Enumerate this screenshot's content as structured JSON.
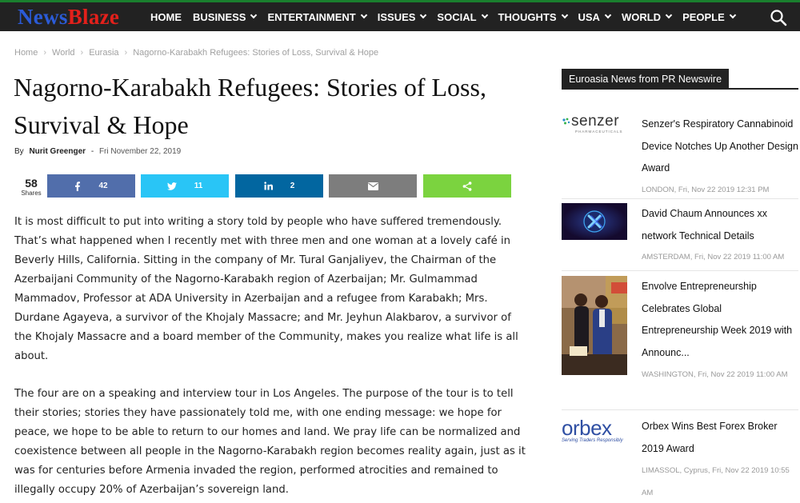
{
  "site": {
    "logo_part1": "News",
    "logo_part2": "Blaze"
  },
  "nav": {
    "items": [
      "HOME",
      "BUSINESS",
      "ENTERTAINMENT",
      "ISSUES",
      "SOCIAL",
      "THOUGHTS",
      "USA",
      "WORLD",
      "PEOPLE"
    ],
    "search_icon": "search-icon"
  },
  "breadcrumb": [
    "Home",
    "World",
    "Eurasia",
    "Nagorno-Karabakh Refugees: Stories of Loss, Survival & Hope"
  ],
  "article": {
    "title": "Nagorno-Karabakh Refugees: Stories of Loss, Survival & Hope",
    "by": "By",
    "author": "Nurit Greenger",
    "separator": "-",
    "date": "Fri November 22, 2019",
    "paragraphs": [
      "It is most difficult to put into writing a story told by people who have suffered tremendously. That’s what happened when I recently met with three men and one woman at a lovely café in Beverly Hills, California. Sitting in the company of Mr. Tural Ganjaliyev, the Chairman of the Azerbaijani Community of the Nagorno-Karabakh region of Azerbaijan; Mr. Gulmammad Mammadov, Professor at ADA University in Azerbaijan and a refugee from Karabakh; Mrs. Durdane Agayeva, a survivor of the Khojaly Massacre; and Mr. Jeyhun Alakbarov, a survivor of the Khojaly Massacre and a board member of the Community, makes you realize what life is all about.",
      "The four are on a speaking and interview tour in Los Angeles. The purpose of the tour is to tell their stories; stories they have passionately told me, with one ending message: we hope for peace, we hope to be able to return to our homes and land. We pray life can be normalized and coexistence between all people in the Nagorno-Karabakh region becomes reality again, just as it was for centuries before Armenia invaded the region, performed atrocities and remained to illegally occupy 20% of Azerbaijan’s sovereign land."
    ]
  },
  "share": {
    "total": "58",
    "total_label": "Shares",
    "buttons": [
      {
        "network": "facebook",
        "count": "42",
        "color": "#516eab",
        "icon": "facebook-icon"
      },
      {
        "network": "twitter",
        "count": "11",
        "color": "#29c5f6",
        "icon": "twitter-icon"
      },
      {
        "network": "linkedin",
        "count": "2",
        "color": "#0266a0",
        "icon": "linkedin-icon"
      },
      {
        "network": "email",
        "count": "",
        "color": "#7d7d7d",
        "icon": "mail-icon"
      },
      {
        "network": "share",
        "count": "",
        "color": "#7bd33f",
        "icon": "share-icon"
      }
    ]
  },
  "sidebar": {
    "heading": "Euroasia News from PR Newswire",
    "items": [
      {
        "title": "Senzer's Respiratory Cannabinoid Device Notches Up Another Design Award",
        "meta": "LONDON, Fri, Nov 22 2019 12:31 PM",
        "logo_text": "senzer",
        "logo_sub": "PHARMACEUTICALS"
      },
      {
        "title": "David Chaum Announces xx network Technical Details",
        "meta": "AMSTERDAM, Fri, Nov 22 2019 11:00 AM",
        "logo_text": ""
      },
      {
        "title": "Envolve Entrepreneurship Celebrates Global Entrepreneurship Week 2019 with Announc...",
        "meta": "WASHINGTON, Fri, Nov 22 2019 11:00 AM",
        "logo_text": ""
      },
      {
        "title": "Orbex Wins Best Forex Broker 2019 Award",
        "meta": "LIMASSOL, Cyprus, Fri, Nov 22 2019 10:55 AM",
        "logo_text": "orbex",
        "logo_sub": "Serving Traders Responsibly"
      }
    ]
  }
}
